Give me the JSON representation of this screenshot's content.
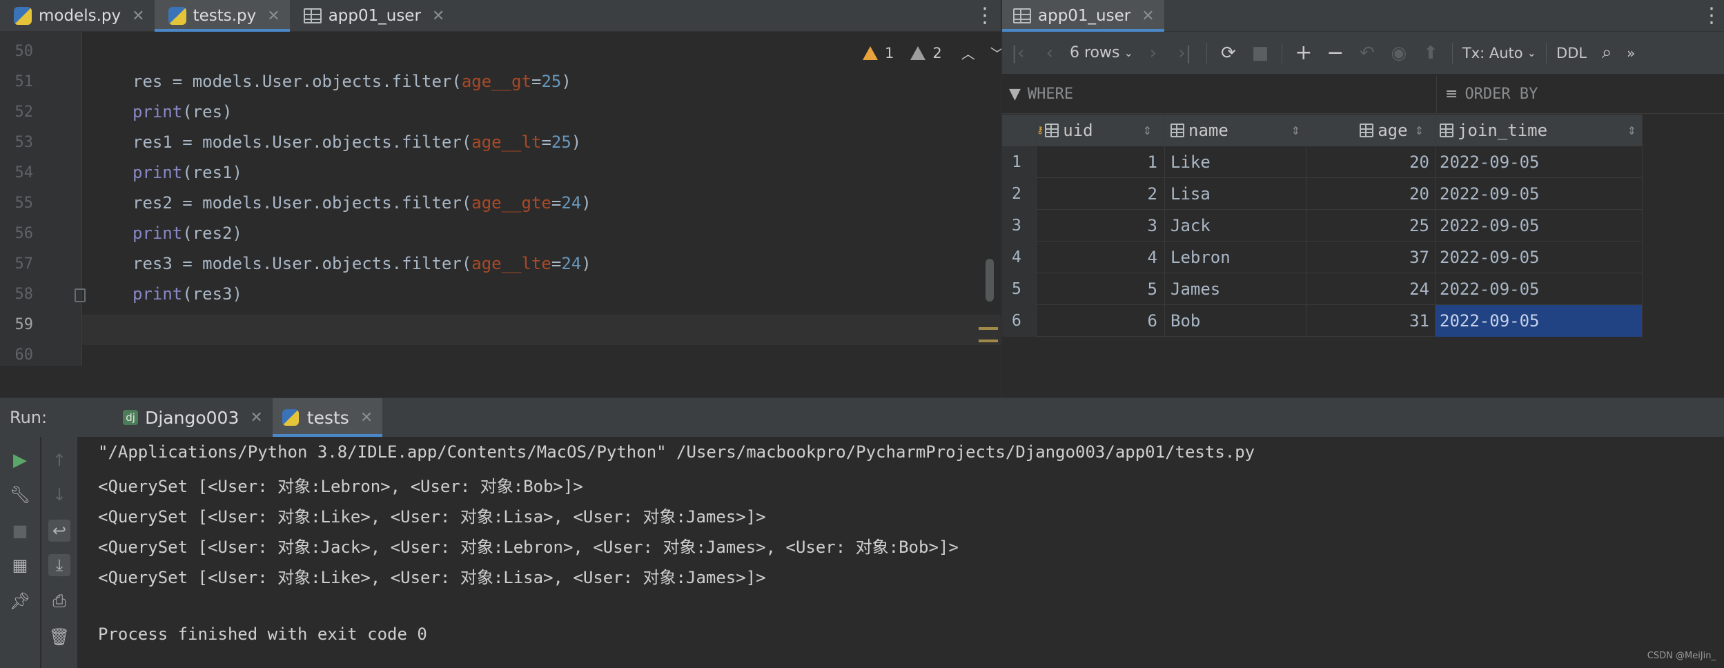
{
  "editor": {
    "tabs": [
      {
        "label": "models.py",
        "icon": "python-file-icon"
      },
      {
        "label": "tests.py",
        "icon": "python-file-icon"
      },
      {
        "label": "app01_user",
        "icon": "table-icon"
      }
    ],
    "inspection": {
      "warnings": "1",
      "weak_warnings": "2"
    },
    "line_numbers": [
      "50",
      "51",
      "52",
      "53",
      "54",
      "55",
      "56",
      "57",
      "58",
      "59",
      "60"
    ],
    "lines": [
      {
        "a": "",
        "b": "",
        "c": "",
        "d": "",
        "e": "",
        "f": ""
      },
      {
        "a": "res = models.User.objects.filter(",
        "b": "age__gt",
        "c": "=",
        "d": "25",
        "e": ")",
        "f": ""
      },
      {
        "print": "print",
        "rest": "(res)"
      },
      {
        "a": "res1 = models.User.objects.filter(",
        "b": "age__lt",
        "c": "=",
        "d": "25",
        "e": ")"
      },
      {
        "print": "print",
        "rest": "(res1)"
      },
      {
        "a": "res2 = models.User.objects.filter(",
        "b": "age__gte",
        "c": "=",
        "d": "24",
        "e": ")"
      },
      {
        "print": "print",
        "rest": "(res2)"
      },
      {
        "a": "res3 = models.User.objects.filter(",
        "b": "age__lte",
        "c": "=",
        "d": "24",
        "e": ")"
      },
      {
        "print": "print",
        "rest": "(res3)"
      }
    ]
  },
  "db": {
    "tab": {
      "label": "app01_user",
      "icon": "table-icon"
    },
    "toolbar": {
      "rows": "6 rows",
      "tx": "Tx: Auto",
      "ddl": "DDL"
    },
    "filter": {
      "where": "WHERE",
      "order_by": "ORDER BY"
    },
    "columns": [
      "uid",
      "name",
      "age",
      "join_time"
    ],
    "rows": [
      {
        "n": "1",
        "uid": "1",
        "name": "Like",
        "age": "20",
        "join_time": "2022-09-05"
      },
      {
        "n": "2",
        "uid": "2",
        "name": "Lisa",
        "age": "20",
        "join_time": "2022-09-05"
      },
      {
        "n": "3",
        "uid": "3",
        "name": "Jack",
        "age": "25",
        "join_time": "2022-09-05"
      },
      {
        "n": "4",
        "uid": "4",
        "name": "Lebron",
        "age": "37",
        "join_time": "2022-09-05"
      },
      {
        "n": "5",
        "uid": "5",
        "name": "James",
        "age": "24",
        "join_time": "2022-09-05"
      },
      {
        "n": "6",
        "uid": "6",
        "name": "Bob",
        "age": "31",
        "join_time": "2022-09-05"
      }
    ],
    "selected_cell": {
      "row": 6,
      "column": "join_time"
    }
  },
  "run": {
    "label": "Run:",
    "tabs": [
      {
        "label": "Django003",
        "icon": "django-icon"
      },
      {
        "label": "tests",
        "icon": "python-file-icon"
      }
    ],
    "output": [
      "\"/Applications/Python 3.8/IDLE.app/Contents/MacOS/Python\" /Users/macbookpro/PycharmProjects/Django003/app01/tests.py",
      "<QuerySet [<User: 对象:Lebron>, <User: 对象:Bob>]>",
      "<QuerySet [<User: 对象:Like>, <User: 对象:Lisa>, <User: 对象:James>]>",
      "<QuerySet [<User: 对象:Jack>, <User: 对象:Lebron>, <User: 对象:James>, <User: 对象:Bob>]>",
      "<QuerySet [<User: 对象:Like>, <User: 对象:Lisa>, <User: 对象:James>]>",
      "",
      "Process finished with exit code 0"
    ]
  },
  "watermark": "CSDN @MeiJin_",
  "colors": {
    "accent": "#4a88c7",
    "selection": "#214283",
    "warning": "#e8a33c"
  }
}
